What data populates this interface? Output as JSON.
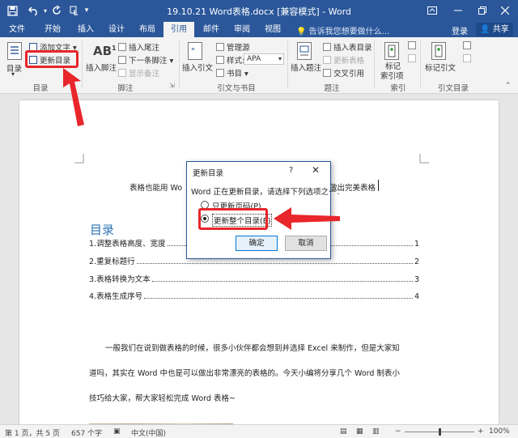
{
  "titlebar": {
    "title": "19.10.21 Word表格.docx [兼容模式] - Word",
    "save_icon": "save-icon",
    "undo_icon": "undo-icon",
    "redo_icon": "redo-icon",
    "touch_icon": "touch-mode-icon",
    "customize_icon": "chevron-down-icon"
  },
  "tabs": [
    "文件",
    "开始",
    "插入",
    "设计",
    "布局",
    "引用",
    "邮件",
    "审阅",
    "视图"
  ],
  "active_tab": "引用",
  "tellme": "告诉我您想要做什么...",
  "login": "登录",
  "share": "共享",
  "ribbon": {
    "toc": {
      "label": "目录",
      "add_text": "添加文字",
      "update_toc": "更新目录",
      "group": "目录"
    },
    "footnotes": {
      "insert_footnote": "插入脚注",
      "ab_glyph": "AB",
      "insert_endnote": "插入尾注",
      "next_footnote": "下一条脚注",
      "show_notes": "显示备注",
      "group": "脚注"
    },
    "citations": {
      "insert_citation": "插入引文",
      "manage_sources": "管理源",
      "style_label": "样式:",
      "style_value": "APA",
      "bibliography": "书目",
      "group": "引文与书目"
    },
    "captions": {
      "insert_caption": "插入题注",
      "insert_table_of_figures": "插入表目录",
      "update_table": "更新表格",
      "cross_reference": "交叉引用",
      "group": "题注"
    },
    "index": {
      "mark_entry_line1": "标记",
      "mark_entry_line2": "索引项",
      "group": "索引"
    },
    "toa": {
      "mark_citation": "标记引文",
      "group": "引文目录"
    }
  },
  "document": {
    "line1_left": "表格也能用 Wo",
    "line1_right": "做出完美表格",
    "toc_heading": "目录",
    "toc": [
      {
        "text": "1.调整表格高度、宽度",
        "page": "1"
      },
      {
        "text": "2.重复标题行",
        "page": "2"
      },
      {
        "text": "3.表格转换为文本",
        "page": "3"
      },
      {
        "text": "4.表格生成序号",
        "page": "4"
      }
    ],
    "paragraph": [
      "一般我们在说到做表格的时候，很多小伙伴都会想到并选择 Excel 来制作，但是大家知",
      "道吗，其实在 Word 中也是可以做出非常漂亮的表格的。今天小编将分享几个 Word 制表小",
      "技巧给大家，帮大家轻松完成 Word 表格~"
    ]
  },
  "dialog": {
    "title": "更新目录",
    "help": "?",
    "close": "✕",
    "message": "Word 正在更新目录，请选择下列选项之一：",
    "option_page_numbers": "只更新页码(P)",
    "option_entire": "更新整个目录(E)",
    "selected_option": "entire",
    "ok": "确定",
    "cancel": "取消"
  },
  "statusbar": {
    "page": "第 1 页，共 5 页",
    "words": "657 个字",
    "language": "中文(中国)",
    "zoom": "100%",
    "zoom_fraction": 0.5
  },
  "colors": {
    "word_blue": "#2b579a",
    "annotation_red": "#e8262b",
    "toc_heading": "#2e74b5"
  }
}
